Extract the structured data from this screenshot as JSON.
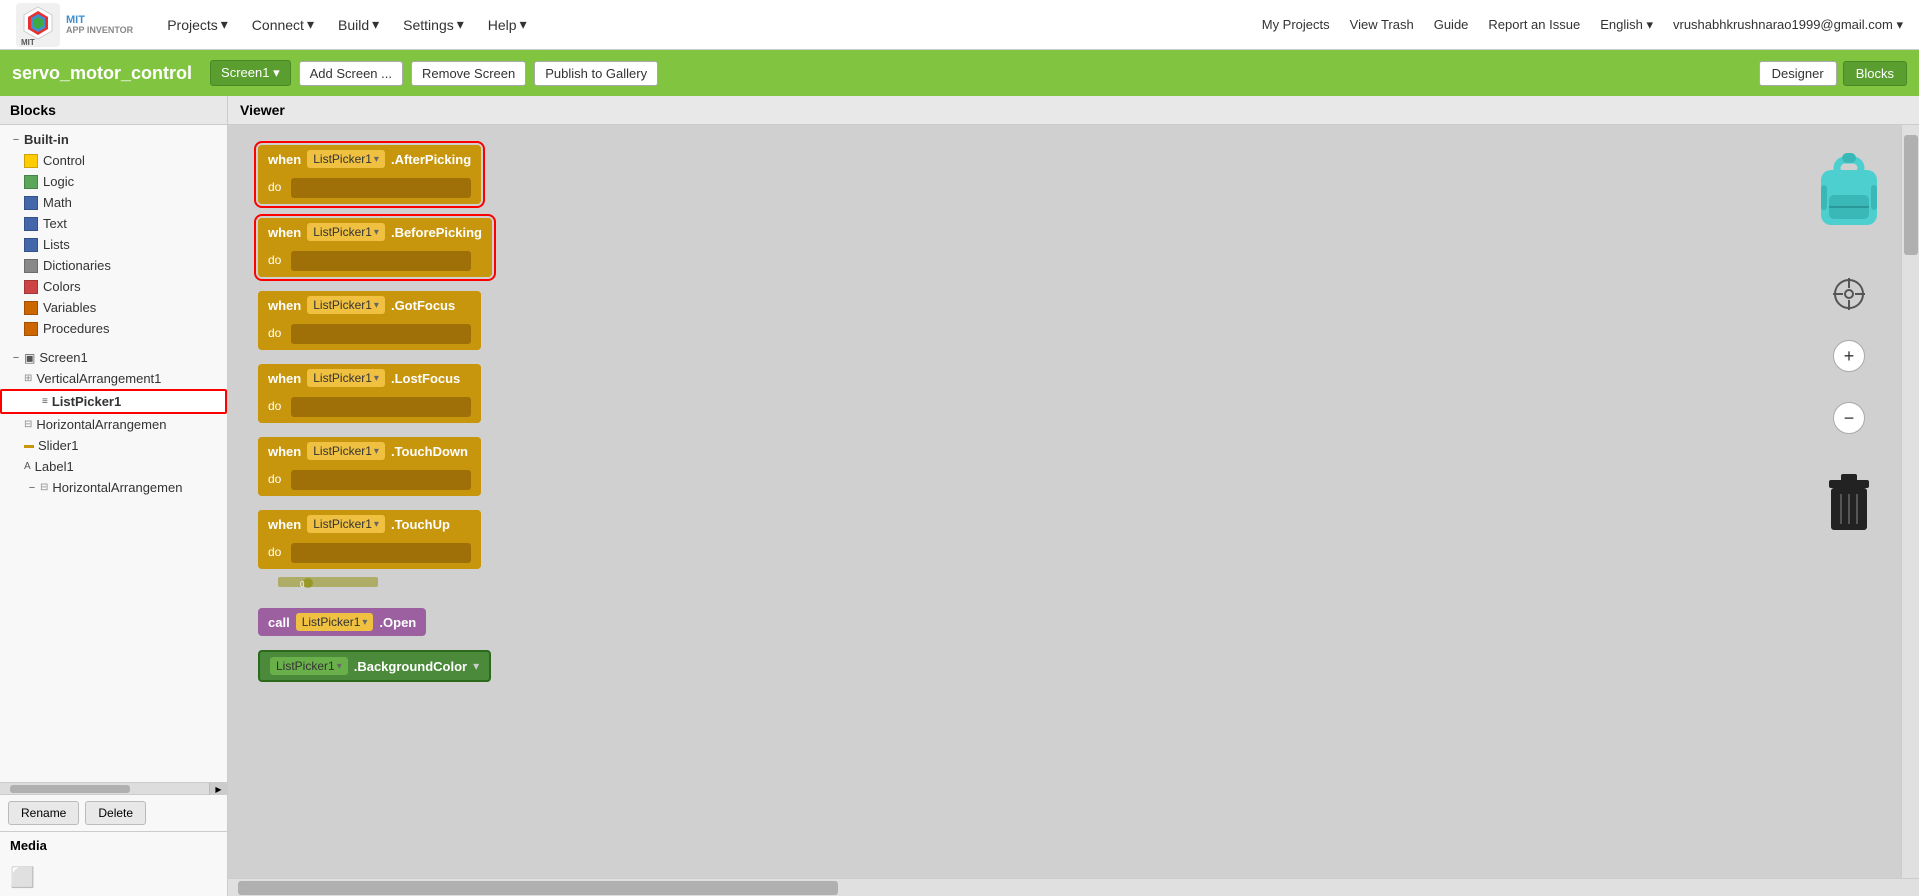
{
  "app": {
    "logo_text": "MIT\nAPP INVENTOR"
  },
  "top_nav": {
    "items": [
      {
        "label": "Projects",
        "has_arrow": true
      },
      {
        "label": "Connect",
        "has_arrow": true
      },
      {
        "label": "Build",
        "has_arrow": true
      },
      {
        "label": "Settings",
        "has_arrow": true
      },
      {
        "label": "Help",
        "has_arrow": true
      }
    ],
    "right_items": [
      {
        "label": "My Projects"
      },
      {
        "label": "View Trash"
      },
      {
        "label": "Guide"
      },
      {
        "label": "Report an Issue"
      },
      {
        "label": "English ▾"
      },
      {
        "label": "vrushabhkrushnarao1999@gmail.com ▾"
      }
    ]
  },
  "project_bar": {
    "project_name": "servo_motor_control",
    "screen_label": "Screen1 ▾",
    "add_screen": "Add Screen ...",
    "remove_screen": "Remove Screen",
    "publish_to_gallery": "Publish to Gallery",
    "designer_btn": "Designer",
    "blocks_btn": "Blocks"
  },
  "sidebar": {
    "header": "Blocks",
    "builtin_label": "Built-in",
    "items": [
      {
        "label": "Control",
        "color": "#ffcc00",
        "indent": 2
      },
      {
        "label": "Logic",
        "color": "#5ba65b",
        "indent": 2
      },
      {
        "label": "Math",
        "color": "#4466aa",
        "indent": 2
      },
      {
        "label": "Text",
        "color": "#4466aa",
        "indent": 2
      },
      {
        "label": "Lists",
        "color": "#4466aa",
        "indent": 2
      },
      {
        "label": "Dictionaries",
        "color": "#888888",
        "indent": 2
      },
      {
        "label": "Colors",
        "color": "#cc4444",
        "indent": 2
      },
      {
        "label": "Variables",
        "color": "#cc6600",
        "indent": 2
      },
      {
        "label": "Procedures",
        "color": "#cc6600",
        "indent": 2
      }
    ],
    "screen1_label": "Screen1",
    "tree_items": [
      {
        "label": "VerticalArrangement1",
        "indent": 3
      },
      {
        "label": "ListPicker1",
        "indent": 4,
        "selected": true
      },
      {
        "label": "HorizontalArrangemen",
        "indent": 3
      },
      {
        "label": "Slider1",
        "indent": 3
      },
      {
        "label": "Label1",
        "indent": 3
      },
      {
        "label": "HorizontalArrangemen",
        "indent": 3,
        "collapsed": true
      }
    ],
    "rename_btn": "Rename",
    "delete_btn": "Delete",
    "media_label": "Media"
  },
  "viewer": {
    "header": "Viewer"
  },
  "blocks": [
    {
      "type": "event",
      "keyword": "when",
      "component": "ListPicker1",
      "event": ".AfterPicking",
      "do_label": "do",
      "red_outline": true
    },
    {
      "type": "event",
      "keyword": "when",
      "component": "ListPicker1",
      "event": ".BeforePicking",
      "do_label": "do",
      "red_outline": true
    },
    {
      "type": "event",
      "keyword": "when",
      "component": "ListPicker1",
      "event": ".GotFocus",
      "do_label": "do",
      "red_outline": false
    },
    {
      "type": "event",
      "keyword": "when",
      "component": "ListPicker1",
      "event": ".LostFocus",
      "do_label": "do",
      "red_outline": false
    },
    {
      "type": "event",
      "keyword": "when",
      "component": "ListPicker1",
      "event": ".TouchDown",
      "do_label": "do",
      "red_outline": false
    },
    {
      "type": "event",
      "keyword": "when",
      "component": "ListPicker1",
      "event": ".TouchUp",
      "do_label": "do",
      "red_outline": false
    },
    {
      "type": "call",
      "keyword": "call",
      "component": "ListPicker1",
      "method": ".Open"
    },
    {
      "type": "property",
      "component": "ListPicker1",
      "property": ".BackgroundColor"
    }
  ],
  "icons": {
    "crosshair": "⊕",
    "zoom_in": "+",
    "zoom_out": "−",
    "dropdown_arrow": "▾",
    "collapse": "−",
    "expand": "+"
  }
}
